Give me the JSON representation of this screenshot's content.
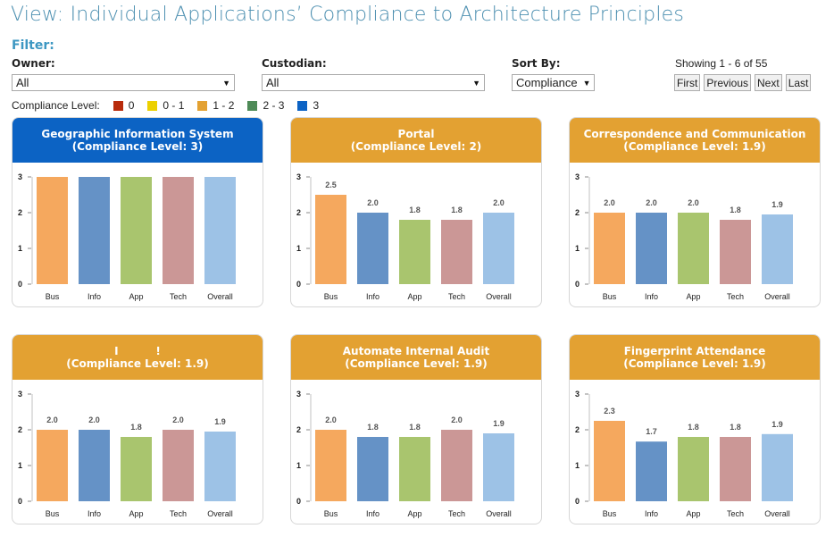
{
  "page": {
    "title": "View: Individual Applications’ Compliance to Architecture Principles",
    "filter_label": "Filter:"
  },
  "filters": {
    "owner": {
      "label": "Owner:",
      "value": "All"
    },
    "custodian": {
      "label": "Custodian:",
      "value": "All"
    },
    "sort_by": {
      "label": "Sort By:",
      "value": "Compliance"
    }
  },
  "pagination": {
    "showing": "Showing 1 - 6 of 55",
    "buttons": [
      "First",
      "Previous",
      "Next",
      "Last"
    ]
  },
  "legend": {
    "label": "Compliance Level:",
    "items": [
      {
        "label": "0",
        "color": "#b82b0c"
      },
      {
        "label": "0 - 1",
        "color": "#ecd000"
      },
      {
        "label": "1 - 2",
        "color": "#e3a132"
      },
      {
        "label": "2 - 3",
        "color": "#4e8a57"
      },
      {
        "label": "3",
        "color": "#0c63c4"
      }
    ]
  },
  "chart_data": [
    {
      "type": "bar",
      "title": "Geographic Information System",
      "subtitle": "(Compliance Level: 3)",
      "header_color": "#0c63c4",
      "categories": [
        "Bus",
        "Info",
        "App",
        "Tech",
        "Overall"
      ],
      "values": [
        3,
        3,
        3,
        3,
        3
      ],
      "value_labels": [
        "",
        "",
        "",
        "",
        ""
      ],
      "ylim": [
        0,
        3
      ],
      "yticks": [
        0,
        1,
        2,
        3
      ]
    },
    {
      "type": "bar",
      "title": "Portal",
      "subtitle": "(Compliance Level: 2)",
      "header_color": "#e3a132",
      "categories": [
        "Bus",
        "Info",
        "App",
        "Tech",
        "Overall"
      ],
      "values": [
        2.5,
        2.0,
        1.8,
        1.8,
        2.0
      ],
      "value_labels": [
        "2.5",
        "2.0",
        "1.8",
        "1.8",
        "2.0"
      ],
      "ylim": [
        0,
        3
      ],
      "yticks": [
        0,
        1,
        2,
        3
      ]
    },
    {
      "type": "bar",
      "title": "Correspondence and Communication",
      "subtitle": "(Compliance Level: 1.9)",
      "header_color": "#e3a132",
      "categories": [
        "Bus",
        "Info",
        "App",
        "Tech",
        "Overall"
      ],
      "values": [
        2.0,
        2.0,
        2.0,
        1.8,
        1.95
      ],
      "value_labels": [
        "2.0",
        "2.0",
        "2.0",
        "1.8",
        "1.9"
      ],
      "ylim": [
        0,
        3
      ],
      "yticks": [
        0,
        1,
        2,
        3
      ]
    },
    {
      "type": "bar",
      "title": "I          !",
      "subtitle": "(Compliance Level: 1.9)",
      "header_color": "#e3a132",
      "categories": [
        "Bus",
        "Info",
        "App",
        "Tech",
        "Overall"
      ],
      "values": [
        2.0,
        2.0,
        1.8,
        2.0,
        1.95
      ],
      "value_labels": [
        "2.0",
        "2.0",
        "1.8",
        "2.0",
        "1.9"
      ],
      "ylim": [
        0,
        3
      ],
      "yticks": [
        0,
        1,
        2,
        3
      ]
    },
    {
      "type": "bar",
      "title": "Automate Internal Audit",
      "subtitle": "(Compliance Level: 1.9)",
      "header_color": "#e3a132",
      "categories": [
        "Bus",
        "Info",
        "App",
        "Tech",
        "Overall"
      ],
      "values": [
        2.0,
        1.8,
        1.8,
        2.0,
        1.9
      ],
      "value_labels": [
        "2.0",
        "1.8",
        "1.8",
        "2.0",
        "1.9"
      ],
      "ylim": [
        0,
        3
      ],
      "yticks": [
        0,
        1,
        2,
        3
      ]
    },
    {
      "type": "bar",
      "title": "Fingerprint Attendance",
      "subtitle": "(Compliance Level: 1.9)",
      "header_color": "#e3a132",
      "categories": [
        "Bus",
        "Info",
        "App",
        "Tech",
        "Overall"
      ],
      "values": [
        2.25,
        1.67,
        1.8,
        1.8,
        1.88
      ],
      "value_labels": [
        "2.3",
        "1.7",
        "1.8",
        "1.8",
        "1.9"
      ],
      "ylim": [
        0,
        3
      ],
      "yticks": [
        0,
        1,
        2,
        3
      ]
    }
  ],
  "bar_colors": [
    "#f5a85e",
    "#6592c6",
    "#a9c56e",
    "#cb9796",
    "#9dc2e6"
  ]
}
